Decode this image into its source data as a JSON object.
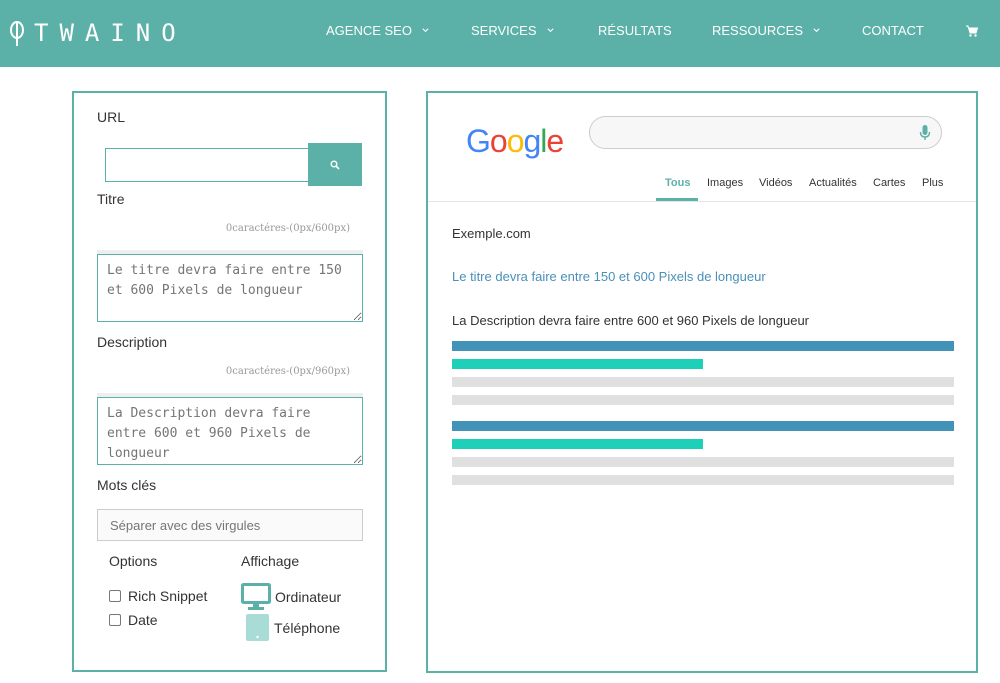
{
  "brand": {
    "name": "TWAINO"
  },
  "nav": [
    {
      "label": "AGENCE SEO",
      "dropdown": true
    },
    {
      "label": "SERVICES",
      "dropdown": true
    },
    {
      "label": "RÉSULTATS",
      "dropdown": false
    },
    {
      "label": "RESSOURCES",
      "dropdown": true
    },
    {
      "label": "CONTACT",
      "dropdown": false
    }
  ],
  "form": {
    "url_label": "URL",
    "url_value": "",
    "title_label": "Titre",
    "title_counter": "0caractéres-(0px/600px)",
    "title_placeholder": "Le titre devra faire entre 150 et 600 Pixels de longueur",
    "desc_label": "Description",
    "desc_counter": "0caractéres-(0px/960px)",
    "desc_placeholder": "La Description devra faire entre 600 et 960 Pixels de longueur",
    "keywords_label": "Mots clés",
    "keywords_placeholder": "Séparer avec des virgules",
    "options_label": "Options",
    "options": [
      {
        "label": "Rich Snippet",
        "checked": false
      },
      {
        "label": "Date",
        "checked": false
      }
    ],
    "display_label": "Affichage",
    "devices": [
      {
        "label": "Ordinateur",
        "icon": "monitor-icon",
        "selected": true
      },
      {
        "label": "Téléphone",
        "icon": "tablet-icon",
        "selected": false
      }
    ]
  },
  "preview": {
    "logo": "Google",
    "tabs": [
      {
        "label": "Tous",
        "active": true
      },
      {
        "label": "Images",
        "active": false
      },
      {
        "label": "Vidéos",
        "active": false
      },
      {
        "label": "Actualités",
        "active": false
      },
      {
        "label": "Cartes",
        "active": false
      },
      {
        "label": "Plus",
        "active": false
      }
    ],
    "result_url": "Exemple.com",
    "result_title": "Le titre devra faire entre 150 et 600 Pixels de longueur",
    "result_description": "La Description devra faire entre 600 et 960 Pixels de longueur"
  },
  "colors": {
    "accent": "#5bb1a8",
    "skeleton_blue": "#4393b8",
    "skeleton_teal": "#1fd0b9",
    "skeleton_grey": "#e0e0e0",
    "link": "#4a90b8"
  }
}
